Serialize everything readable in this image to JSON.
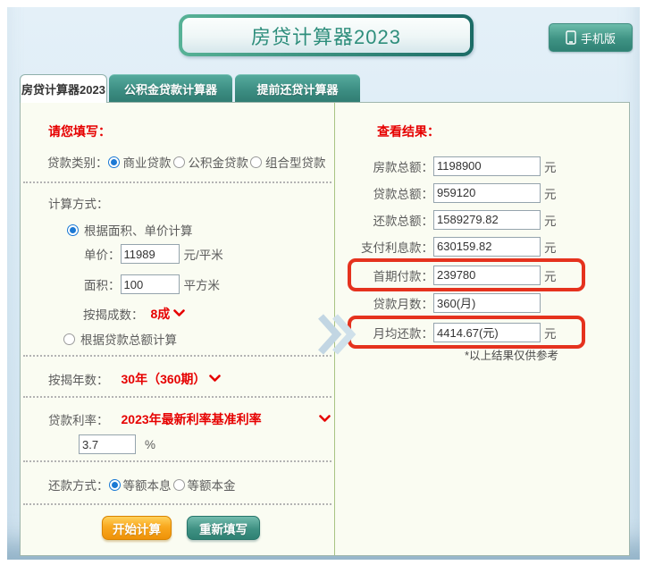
{
  "header": {
    "title": "房贷计算器2023",
    "mobile_button": "手机版"
  },
  "tabs": [
    {
      "label": "房贷计算器2023"
    },
    {
      "label": "公积金贷款计算器"
    },
    {
      "label": "提前还贷计算器"
    }
  ],
  "form": {
    "section_title": "请您填写：",
    "loan_type": {
      "label": "贷款类别：",
      "options": [
        "商业贷款",
        "公积金贷款",
        "组合型贷款"
      ],
      "selected": "商业贷款"
    },
    "calc_method": {
      "label": "计算方式：",
      "option_area": "根据面积、单价计算",
      "option_total": "根据贷款总额计算",
      "selected": "根据面积、单价计算"
    },
    "unit_price": {
      "label": "单价：",
      "value": "11989",
      "unit": "元/平米"
    },
    "area": {
      "label": "面积：",
      "value": "100",
      "unit": "平方米"
    },
    "mortgage_ratio": {
      "label": "按揭成数：",
      "value": "8成"
    },
    "years": {
      "label": "按揭年数：",
      "value": "30年（360期）"
    },
    "rate": {
      "label": "贷款利率：",
      "value": "2023年最新利率基准利率",
      "rate_value": "3.7",
      "unit": "%"
    },
    "repayment": {
      "label": "还款方式：",
      "options": [
        "等额本息",
        "等额本金"
      ],
      "selected": "等额本息"
    },
    "buttons": {
      "calculate": "开始计算",
      "reset": "重新填写"
    }
  },
  "results": {
    "section_title": "查看结果：",
    "rows": [
      {
        "label": "房款总额：",
        "value": "1198900",
        "unit": "元"
      },
      {
        "label": "贷款总额：",
        "value": "959120",
        "unit": "元"
      },
      {
        "label": "还款总额：",
        "value": "1589279.82",
        "unit": "元"
      },
      {
        "label": "支付利息款：",
        "value": "630159.82",
        "unit": "元"
      },
      {
        "label": "首期付款：",
        "value": "239780",
        "unit": "元"
      },
      {
        "label": "贷款月数：",
        "value": "360(月)",
        "unit": ""
      },
      {
        "label": "月均还款：",
        "value": "4414.67(元)",
        "unit": "元"
      }
    ],
    "disclaimer": "*以上结果仅供参考"
  },
  "colors": {
    "accent_teal": "#3b8c81",
    "accent_red": "#e60000",
    "highlight_box": "#e5321e",
    "button_orange": "#f9a81e",
    "frame_blue": "#d8e9f4",
    "panel_green": "#fafcf2"
  }
}
